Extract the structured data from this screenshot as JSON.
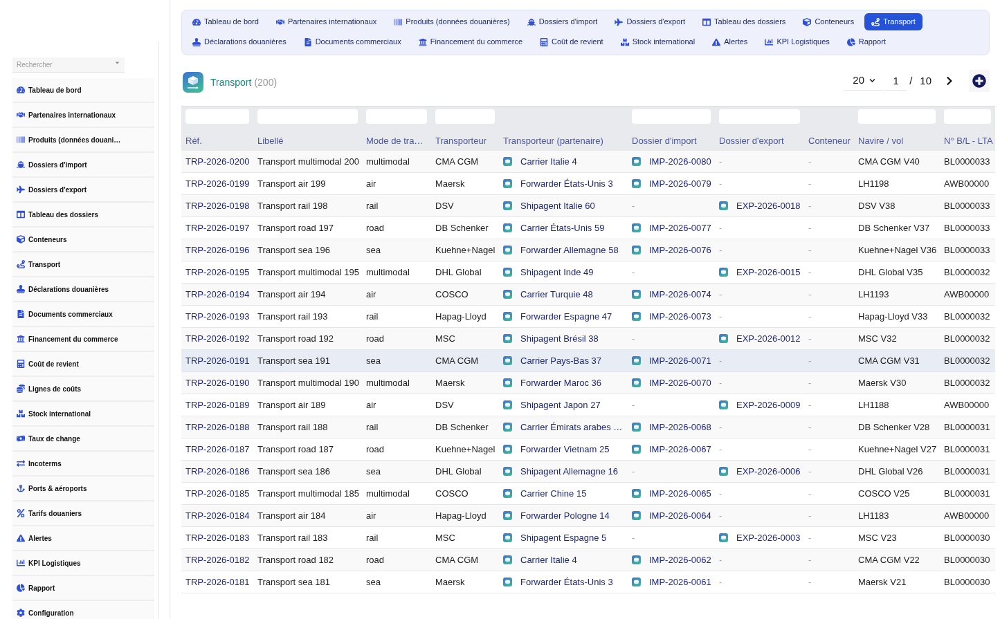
{
  "sidebar": {
    "search": {
      "placeholder": "Rechercher"
    },
    "items": [
      {
        "label": "Tableau de bord",
        "kind": "dashboard"
      },
      {
        "label": "Partenaires internationaux",
        "kind": "partners"
      },
      {
        "label": "Produits (données douani…",
        "kind": "products"
      },
      {
        "label": "Dossiers d'import",
        "kind": "imports"
      },
      {
        "label": "Dossiers d'export",
        "kind": "exports"
      },
      {
        "label": "Tableau des dossiers",
        "kind": "board"
      },
      {
        "label": "Conteneurs",
        "kind": "containers"
      },
      {
        "label": "Transport",
        "kind": "transport"
      },
      {
        "label": "Déclarations douanières",
        "kind": "declarations"
      },
      {
        "label": "Documents commerciaux",
        "kind": "documents"
      },
      {
        "label": "Financement du commerce",
        "kind": "financing"
      },
      {
        "label": "Coût de revient",
        "kind": "costing"
      },
      {
        "label": "Lignes de coûts",
        "kind": "costlines"
      },
      {
        "label": "Stock international",
        "kind": "stock"
      },
      {
        "label": "Taux de change",
        "kind": "exchange"
      },
      {
        "label": "Incoterms",
        "kind": "incoterms"
      },
      {
        "label": "Ports & aéroports",
        "kind": "ports"
      },
      {
        "label": "Tarifs douaniers",
        "kind": "tariffs"
      },
      {
        "label": "Alertes",
        "kind": "alerts"
      },
      {
        "label": "KPI Logistiques",
        "kind": "kpi"
      },
      {
        "label": "Rapport",
        "kind": "report"
      },
      {
        "label": "Configuration",
        "kind": "settings"
      }
    ]
  },
  "top_nav": [
    {
      "label": "Tableau de bord",
      "kind": "dashboard",
      "selected": false
    },
    {
      "label": "Partenaires internationaux",
      "kind": "partners",
      "selected": false
    },
    {
      "label": "Produits (données douanières)",
      "kind": "products",
      "selected": false
    },
    {
      "label": "Dossiers d'import",
      "kind": "imports",
      "selected": false
    },
    {
      "label": "Dossiers d'export",
      "kind": "exports",
      "selected": false
    },
    {
      "label": "Tableau des dossiers",
      "kind": "board",
      "selected": false
    },
    {
      "label": "Conteneurs",
      "kind": "containers",
      "selected": false
    },
    {
      "label": "Transport",
      "kind": "transport",
      "selected": true
    },
    {
      "label": "Déclarations douanières",
      "kind": "declarations",
      "selected": false
    },
    {
      "label": "Documents commerciaux",
      "kind": "documents",
      "selected": false
    },
    {
      "label": "Financement du commerce",
      "kind": "financing",
      "selected": false
    },
    {
      "label": "Coût de revient",
      "kind": "costing",
      "selected": false
    },
    {
      "label": "Stock international",
      "kind": "stock",
      "selected": false
    },
    {
      "label": "Alertes",
      "kind": "alerts",
      "selected": false
    },
    {
      "label": "KPI Logistiques",
      "kind": "kpi",
      "selected": false
    },
    {
      "label": "Rapport",
      "kind": "report",
      "selected": false
    }
  ],
  "header": {
    "title": "Transport",
    "count": "(200)"
  },
  "pagination": {
    "page_size": "20",
    "page": "1",
    "separator": "/",
    "total_pages": "10"
  },
  "table": {
    "columns": [
      {
        "label": "Réf.",
        "filter": true
      },
      {
        "label": "Libellé",
        "filter": true
      },
      {
        "label": "Mode de tra…",
        "filter": true
      },
      {
        "label": "Transporteur",
        "filter": true
      },
      {
        "label": "Transporteur (partenaire)",
        "filter": false
      },
      {
        "label": "Dossier d'import",
        "filter": true
      },
      {
        "label": "Dossier d'export",
        "filter": true
      },
      {
        "label": "Conteneur",
        "filter": false
      },
      {
        "label": "Navire / vol",
        "filter": true
      },
      {
        "label": "N° B/L - LTA",
        "filter": true
      }
    ],
    "rows": [
      {
        "selected": false,
        "cells": [
          {
            "text": "TRP-2026-0200",
            "kind": "link"
          },
          {
            "text": "Transport multimodal 200",
            "kind": "text"
          },
          {
            "text": "multimodal",
            "kind": "text"
          },
          {
            "text": "CMA CGM",
            "kind": "text"
          },
          {
            "text": "Carrier Italie 4",
            "kind": "entity"
          },
          {
            "text": "IMP-2026-0080",
            "kind": "entity"
          },
          {
            "text": "-",
            "kind": "empty"
          },
          {
            "text": "-",
            "kind": "empty"
          },
          {
            "text": "CMA CGM V40",
            "kind": "text"
          },
          {
            "text": "BL0000033",
            "kind": "text"
          }
        ]
      },
      {
        "selected": false,
        "cells": [
          {
            "text": "TRP-2026-0199",
            "kind": "link"
          },
          {
            "text": "Transport air 199",
            "kind": "text"
          },
          {
            "text": "air",
            "kind": "text"
          },
          {
            "text": "Maersk",
            "kind": "text"
          },
          {
            "text": "Forwarder États-Unis 3",
            "kind": "entity"
          },
          {
            "text": "IMP-2026-0079",
            "kind": "entity"
          },
          {
            "text": "-",
            "kind": "empty"
          },
          {
            "text": "-",
            "kind": "empty"
          },
          {
            "text": "LH1198",
            "kind": "text"
          },
          {
            "text": "AWB00000",
            "kind": "text"
          }
        ]
      },
      {
        "selected": false,
        "cells": [
          {
            "text": "TRP-2026-0198",
            "kind": "link"
          },
          {
            "text": "Transport rail 198",
            "kind": "text"
          },
          {
            "text": "rail",
            "kind": "text"
          },
          {
            "text": "DSV",
            "kind": "text"
          },
          {
            "text": "Shipagent Italie 60",
            "kind": "entity"
          },
          {
            "text": "-",
            "kind": "empty"
          },
          {
            "text": "EXP-2026-0018",
            "kind": "entity"
          },
          {
            "text": "-",
            "kind": "empty"
          },
          {
            "text": "DSV V38",
            "kind": "text"
          },
          {
            "text": "BL0000033",
            "kind": "text"
          }
        ]
      },
      {
        "selected": false,
        "cells": [
          {
            "text": "TRP-2026-0197",
            "kind": "link"
          },
          {
            "text": "Transport road 197",
            "kind": "text"
          },
          {
            "text": "road",
            "kind": "text"
          },
          {
            "text": "DB Schenker",
            "kind": "text"
          },
          {
            "text": "Carrier États-Unis 59",
            "kind": "entity"
          },
          {
            "text": "IMP-2026-0077",
            "kind": "entity"
          },
          {
            "text": "-",
            "kind": "empty"
          },
          {
            "text": "-",
            "kind": "empty"
          },
          {
            "text": "DB Schenker V37",
            "kind": "text"
          },
          {
            "text": "BL0000033",
            "kind": "text"
          }
        ]
      },
      {
        "selected": false,
        "cells": [
          {
            "text": "TRP-2026-0196",
            "kind": "link"
          },
          {
            "text": "Transport sea 196",
            "kind": "text"
          },
          {
            "text": "sea",
            "kind": "text"
          },
          {
            "text": "Kuehne+Nagel",
            "kind": "text"
          },
          {
            "text": "Forwarder Allemagne 58",
            "kind": "entity"
          },
          {
            "text": "IMP-2026-0076",
            "kind": "entity"
          },
          {
            "text": "-",
            "kind": "empty"
          },
          {
            "text": "-",
            "kind": "empty"
          },
          {
            "text": "Kuehne+Nagel V36",
            "kind": "text"
          },
          {
            "text": "BL0000033",
            "kind": "text"
          }
        ]
      },
      {
        "selected": false,
        "cells": [
          {
            "text": "TRP-2026-0195",
            "kind": "link"
          },
          {
            "text": "Transport multimodal 195",
            "kind": "text"
          },
          {
            "text": "multimodal",
            "kind": "text"
          },
          {
            "text": "DHL Global",
            "kind": "text"
          },
          {
            "text": "Shipagent Inde 49",
            "kind": "entity"
          },
          {
            "text": "-",
            "kind": "empty"
          },
          {
            "text": "EXP-2026-0015",
            "kind": "entity"
          },
          {
            "text": "-",
            "kind": "empty"
          },
          {
            "text": "DHL Global V35",
            "kind": "text"
          },
          {
            "text": "BL0000032",
            "kind": "text"
          }
        ]
      },
      {
        "selected": false,
        "cells": [
          {
            "text": "TRP-2026-0194",
            "kind": "link"
          },
          {
            "text": "Transport air 194",
            "kind": "text"
          },
          {
            "text": "air",
            "kind": "text"
          },
          {
            "text": "COSCO",
            "kind": "text"
          },
          {
            "text": "Carrier Turquie 48",
            "kind": "entity"
          },
          {
            "text": "IMP-2026-0074",
            "kind": "entity"
          },
          {
            "text": "-",
            "kind": "empty"
          },
          {
            "text": "-",
            "kind": "empty"
          },
          {
            "text": "LH1193",
            "kind": "text"
          },
          {
            "text": "AWB00000",
            "kind": "text"
          }
        ]
      },
      {
        "selected": false,
        "cells": [
          {
            "text": "TRP-2026-0193",
            "kind": "link"
          },
          {
            "text": "Transport rail 193",
            "kind": "text"
          },
          {
            "text": "rail",
            "kind": "text"
          },
          {
            "text": "Hapag-Lloyd",
            "kind": "text"
          },
          {
            "text": "Forwarder Espagne 47",
            "kind": "entity"
          },
          {
            "text": "IMP-2026-0073",
            "kind": "entity"
          },
          {
            "text": "-",
            "kind": "empty"
          },
          {
            "text": "-",
            "kind": "empty"
          },
          {
            "text": "Hapag-Lloyd V33",
            "kind": "text"
          },
          {
            "text": "BL0000032",
            "kind": "text"
          }
        ]
      },
      {
        "selected": false,
        "cells": [
          {
            "text": "TRP-2026-0192",
            "kind": "link"
          },
          {
            "text": "Transport road 192",
            "kind": "text"
          },
          {
            "text": "road",
            "kind": "text"
          },
          {
            "text": "MSC",
            "kind": "text"
          },
          {
            "text": "Shipagent Brésil 38",
            "kind": "entity"
          },
          {
            "text": "-",
            "kind": "empty"
          },
          {
            "text": "EXP-2026-0012",
            "kind": "entity"
          },
          {
            "text": "-",
            "kind": "empty"
          },
          {
            "text": "MSC V32",
            "kind": "text"
          },
          {
            "text": "BL0000032",
            "kind": "text"
          }
        ]
      },
      {
        "selected": true,
        "cells": [
          {
            "text": "TRP-2026-0191",
            "kind": "link"
          },
          {
            "text": "Transport sea 191",
            "kind": "text"
          },
          {
            "text": "sea",
            "kind": "text"
          },
          {
            "text": "CMA CGM",
            "kind": "text"
          },
          {
            "text": "Carrier Pays-Bas 37",
            "kind": "entity"
          },
          {
            "text": "IMP-2026-0071",
            "kind": "entity"
          },
          {
            "text": "-",
            "kind": "empty"
          },
          {
            "text": "-",
            "kind": "empty"
          },
          {
            "text": "CMA CGM V31",
            "kind": "text"
          },
          {
            "text": "BL0000032",
            "kind": "text"
          }
        ]
      },
      {
        "selected": false,
        "cells": [
          {
            "text": "TRP-2026-0190",
            "kind": "link"
          },
          {
            "text": "Transport multimodal 190",
            "kind": "text"
          },
          {
            "text": "multimodal",
            "kind": "text"
          },
          {
            "text": "Maersk",
            "kind": "text"
          },
          {
            "text": "Forwarder Maroc 36",
            "kind": "entity"
          },
          {
            "text": "IMP-2026-0070",
            "kind": "entity"
          },
          {
            "text": "-",
            "kind": "empty"
          },
          {
            "text": "-",
            "kind": "empty"
          },
          {
            "text": "Maersk V30",
            "kind": "text"
          },
          {
            "text": "BL0000032",
            "kind": "text"
          }
        ]
      },
      {
        "selected": false,
        "cells": [
          {
            "text": "TRP-2026-0189",
            "kind": "link"
          },
          {
            "text": "Transport air 189",
            "kind": "text"
          },
          {
            "text": "air",
            "kind": "text"
          },
          {
            "text": "DSV",
            "kind": "text"
          },
          {
            "text": "Shipagent Japon 27",
            "kind": "entity"
          },
          {
            "text": "-",
            "kind": "empty"
          },
          {
            "text": "EXP-2026-0009",
            "kind": "entity"
          },
          {
            "text": "-",
            "kind": "empty"
          },
          {
            "text": "LH1188",
            "kind": "text"
          },
          {
            "text": "AWB00000",
            "kind": "text"
          }
        ]
      },
      {
        "selected": false,
        "cells": [
          {
            "text": "TRP-2026-0188",
            "kind": "link"
          },
          {
            "text": "Transport rail 188",
            "kind": "text"
          },
          {
            "text": "rail",
            "kind": "text"
          },
          {
            "text": "DB Schenker",
            "kind": "text"
          },
          {
            "text": "Carrier Émirats arabes …",
            "kind": "entity"
          },
          {
            "text": "IMP-2026-0068",
            "kind": "entity"
          },
          {
            "text": "-",
            "kind": "empty"
          },
          {
            "text": "-",
            "kind": "empty"
          },
          {
            "text": "DB Schenker V28",
            "kind": "text"
          },
          {
            "text": "BL0000031",
            "kind": "text"
          }
        ]
      },
      {
        "selected": false,
        "cells": [
          {
            "text": "TRP-2026-0187",
            "kind": "link"
          },
          {
            "text": "Transport road 187",
            "kind": "text"
          },
          {
            "text": "road",
            "kind": "text"
          },
          {
            "text": "Kuehne+Nagel",
            "kind": "text"
          },
          {
            "text": "Forwarder Vietnam 25",
            "kind": "entity"
          },
          {
            "text": "IMP-2026-0067",
            "kind": "entity"
          },
          {
            "text": "-",
            "kind": "empty"
          },
          {
            "text": "-",
            "kind": "empty"
          },
          {
            "text": "Kuehne+Nagel V27",
            "kind": "text"
          },
          {
            "text": "BL0000031",
            "kind": "text"
          }
        ]
      },
      {
        "selected": false,
        "cells": [
          {
            "text": "TRP-2026-0186",
            "kind": "link"
          },
          {
            "text": "Transport sea 186",
            "kind": "text"
          },
          {
            "text": "sea",
            "kind": "text"
          },
          {
            "text": "DHL Global",
            "kind": "text"
          },
          {
            "text": "Shipagent Allemagne 16",
            "kind": "entity"
          },
          {
            "text": "-",
            "kind": "empty"
          },
          {
            "text": "EXP-2026-0006",
            "kind": "entity"
          },
          {
            "text": "-",
            "kind": "empty"
          },
          {
            "text": "DHL Global V26",
            "kind": "text"
          },
          {
            "text": "BL0000031",
            "kind": "text"
          }
        ]
      },
      {
        "selected": false,
        "cells": [
          {
            "text": "TRP-2026-0185",
            "kind": "link"
          },
          {
            "text": "Transport multimodal 185",
            "kind": "text"
          },
          {
            "text": "multimodal",
            "kind": "text"
          },
          {
            "text": "COSCO",
            "kind": "text"
          },
          {
            "text": "Carrier Chine 15",
            "kind": "entity"
          },
          {
            "text": "IMP-2026-0065",
            "kind": "entity"
          },
          {
            "text": "-",
            "kind": "empty"
          },
          {
            "text": "-",
            "kind": "empty"
          },
          {
            "text": "COSCO V25",
            "kind": "text"
          },
          {
            "text": "BL0000031",
            "kind": "text"
          }
        ]
      },
      {
        "selected": false,
        "cells": [
          {
            "text": "TRP-2026-0184",
            "kind": "link"
          },
          {
            "text": "Transport air 184",
            "kind": "text"
          },
          {
            "text": "air",
            "kind": "text"
          },
          {
            "text": "Hapag-Lloyd",
            "kind": "text"
          },
          {
            "text": "Forwarder Pologne 14",
            "kind": "entity"
          },
          {
            "text": "IMP-2026-0064",
            "kind": "entity"
          },
          {
            "text": "-",
            "kind": "empty"
          },
          {
            "text": "-",
            "kind": "empty"
          },
          {
            "text": "LH1183",
            "kind": "text"
          },
          {
            "text": "AWB00000",
            "kind": "text"
          }
        ]
      },
      {
        "selected": false,
        "cells": [
          {
            "text": "TRP-2026-0183",
            "kind": "link"
          },
          {
            "text": "Transport rail 183",
            "kind": "text"
          },
          {
            "text": "rail",
            "kind": "text"
          },
          {
            "text": "MSC",
            "kind": "text"
          },
          {
            "text": "Shipagent Espagne 5",
            "kind": "entity"
          },
          {
            "text": "-",
            "kind": "empty"
          },
          {
            "text": "EXP-2026-0003",
            "kind": "entity"
          },
          {
            "text": "-",
            "kind": "empty"
          },
          {
            "text": "MSC V23",
            "kind": "text"
          },
          {
            "text": "BL0000030",
            "kind": "text"
          }
        ]
      },
      {
        "selected": false,
        "cells": [
          {
            "text": "TRP-2026-0182",
            "kind": "link"
          },
          {
            "text": "Transport road 182",
            "kind": "text"
          },
          {
            "text": "road",
            "kind": "text"
          },
          {
            "text": "CMA CGM",
            "kind": "text"
          },
          {
            "text": "Carrier Italie 4",
            "kind": "entity"
          },
          {
            "text": "IMP-2026-0062",
            "kind": "entity"
          },
          {
            "text": "-",
            "kind": "empty"
          },
          {
            "text": "-",
            "kind": "empty"
          },
          {
            "text": "CMA CGM V22",
            "kind": "text"
          },
          {
            "text": "BL0000030",
            "kind": "text"
          }
        ]
      },
      {
        "selected": false,
        "cells": [
          {
            "text": "TRP-2026-0181",
            "kind": "link"
          },
          {
            "text": "Transport sea 181",
            "kind": "text"
          },
          {
            "text": "sea",
            "kind": "text"
          },
          {
            "text": "Maersk",
            "kind": "text"
          },
          {
            "text": "Forwarder États-Unis 3",
            "kind": "entity"
          },
          {
            "text": "IMP-2026-0061",
            "kind": "entity"
          },
          {
            "text": "-",
            "kind": "empty"
          },
          {
            "text": "-",
            "kind": "empty"
          },
          {
            "text": "Maersk V21",
            "kind": "text"
          },
          {
            "text": "BL0000030",
            "kind": "text"
          }
        ]
      }
    ]
  }
}
